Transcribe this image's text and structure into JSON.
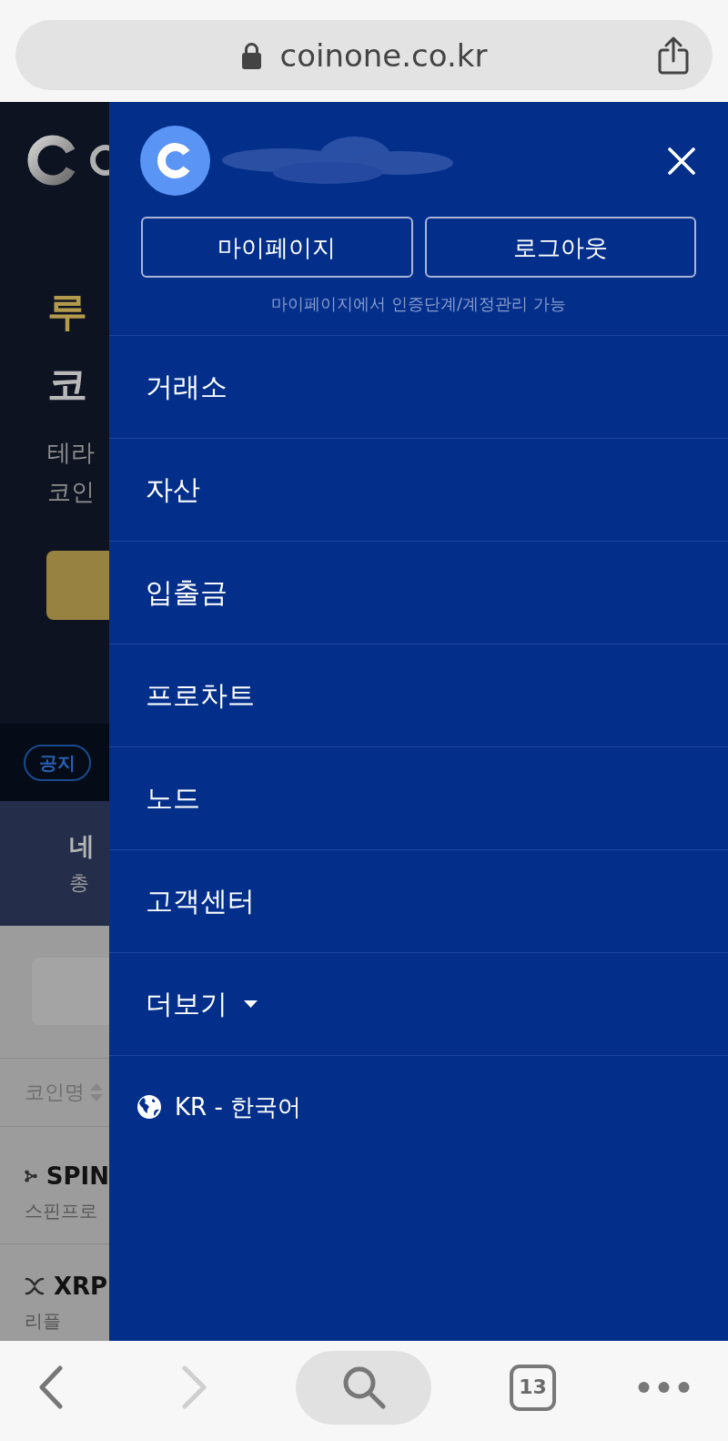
{
  "address_bar": {
    "url": "coinone.co.kr"
  },
  "page": {
    "hero": {
      "title_lines": [
        "루",
        "코"
      ],
      "subtitle_lines": [
        "테라",
        "코인"
      ]
    },
    "notice_badge": "공지",
    "banner": {
      "title": "네",
      "subtitle": "총"
    },
    "table": {
      "columns": [
        "코인명"
      ],
      "rows": [
        {
          "symbol": "SPIN",
          "name": "스핀프로"
        },
        {
          "symbol": "XRP",
          "name": "리플"
        }
      ]
    }
  },
  "drawer": {
    "buttons": [
      "마이페이지",
      "로그아웃"
    ],
    "hint": "마이페이지에서 인증단계/계정관리 가능",
    "menu": [
      {
        "label": "거래소",
        "kind": "link"
      },
      {
        "label": "자산",
        "kind": "link"
      },
      {
        "label": "입출금",
        "kind": "link"
      },
      {
        "label": "프로차트",
        "kind": "link"
      },
      {
        "label": "노드",
        "kind": "link"
      },
      {
        "label": "고객센터",
        "kind": "link"
      },
      {
        "label": "더보기",
        "kind": "dropdown"
      }
    ],
    "language": "KR - 한국어"
  },
  "toolbar": {
    "back": {
      "disabled": false
    },
    "forward": {
      "disabled": true
    },
    "tab_count": "13"
  }
}
